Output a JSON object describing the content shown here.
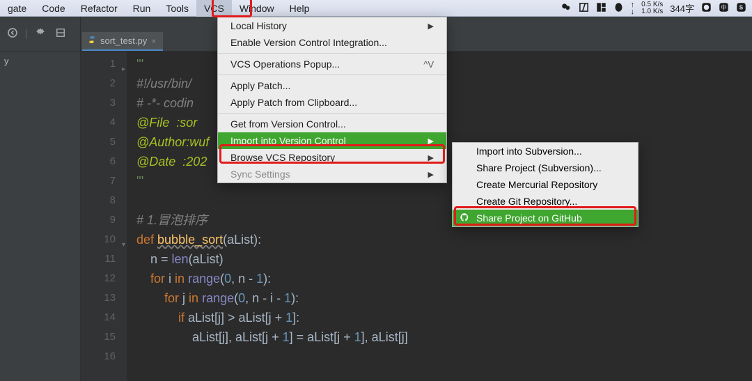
{
  "menubar": {
    "items": [
      "gate",
      "Code",
      "Refactor",
      "Run",
      "Tools",
      "VCS",
      "Window",
      "Help"
    ],
    "active_index": 5,
    "right": {
      "net_up": "0.5 K/s",
      "net_down": "1.0 K/s",
      "word_count": "344字"
    }
  },
  "toolrow": {
    "icons": [
      "back-icon",
      "divider",
      "gear-icon",
      "collapse-icon"
    ]
  },
  "left_tree": {
    "item0": "y"
  },
  "tab": {
    "filename": "sort_test.py",
    "close": "×"
  },
  "editor": {
    "lines": [
      {
        "n": "1",
        "html": "<span class='c-string'>'''</span>"
      },
      {
        "n": "2",
        "html": "<span class='c-comment'>#!/usr/bin/</span>"
      },
      {
        "n": "3",
        "html": "<span class='c-comment'># -*- codin</span>"
      },
      {
        "n": "4",
        "html": "<span class='c-todo'>@File  :sor</span>"
      },
      {
        "n": "5",
        "html": "<span class='c-todo'>@Author:wuf</span>"
      },
      {
        "n": "6",
        "html": "<span class='c-todo'>@Date  :202</span>"
      },
      {
        "n": "7",
        "html": "<span class='c-string'>'''</span>"
      },
      {
        "n": "8",
        "html": ""
      },
      {
        "n": "9",
        "html": "<span class='c-comment'># 1.冒泡排序</span>"
      },
      {
        "n": "10",
        "html": "<span class='c-key'>def </span><span class='c-def underline'>bubble_sort</span>(aList):"
      },
      {
        "n": "11",
        "html": "    n = <span class='c-builtin'>len</span>(aList)"
      },
      {
        "n": "12",
        "html": "    <span class='c-key'>for</span> i <span class='c-key'>in</span> <span class='c-builtin'>range</span>(<span class='c-num'>0</span>, n - <span class='c-num'>1</span>):"
      },
      {
        "n": "13",
        "html": "        <span class='c-key'>for</span> j <span class='c-key'>in</span> <span class='c-builtin'>range</span>(<span class='c-num'>0</span>, n - i - <span class='c-num'>1</span>):"
      },
      {
        "n": "14",
        "html": "            <span class='c-key'>if</span> aList[j] &gt; aList[j + <span class='c-num'>1</span>]:"
      },
      {
        "n": "15",
        "html": "                aList[j], aList[j + <span class='c-num'>1</span>] = aList[j + <span class='c-num'>1</span>], aList[j]"
      },
      {
        "n": "16",
        "html": ""
      }
    ]
  },
  "vcs_menu": {
    "items": [
      {
        "label": "Local History",
        "arrow": true
      },
      {
        "label": "Enable Version Control Integration..."
      },
      {
        "divider": true
      },
      {
        "label": "VCS Operations Popup...",
        "shortcut": "^V"
      },
      {
        "divider": true
      },
      {
        "label": "Apply Patch..."
      },
      {
        "label": "Apply Patch from Clipboard..."
      },
      {
        "divider": true
      },
      {
        "label": "Get from Version Control..."
      },
      {
        "label": "Import into Version Control",
        "arrow": true,
        "highlight": true
      },
      {
        "label": "Browse VCS Repository",
        "arrow": true
      },
      {
        "label": "Sync Settings",
        "arrow": true,
        "disabled": true
      }
    ]
  },
  "import_submenu": {
    "items": [
      {
        "label": "Import into Subversion..."
      },
      {
        "label": "Share Project (Subversion)..."
      },
      {
        "label": "Create Mercurial Repository"
      },
      {
        "label": "Create Git Repository..."
      },
      {
        "label": "Share Project on GitHub",
        "highlight": true,
        "icon": "github"
      }
    ]
  }
}
